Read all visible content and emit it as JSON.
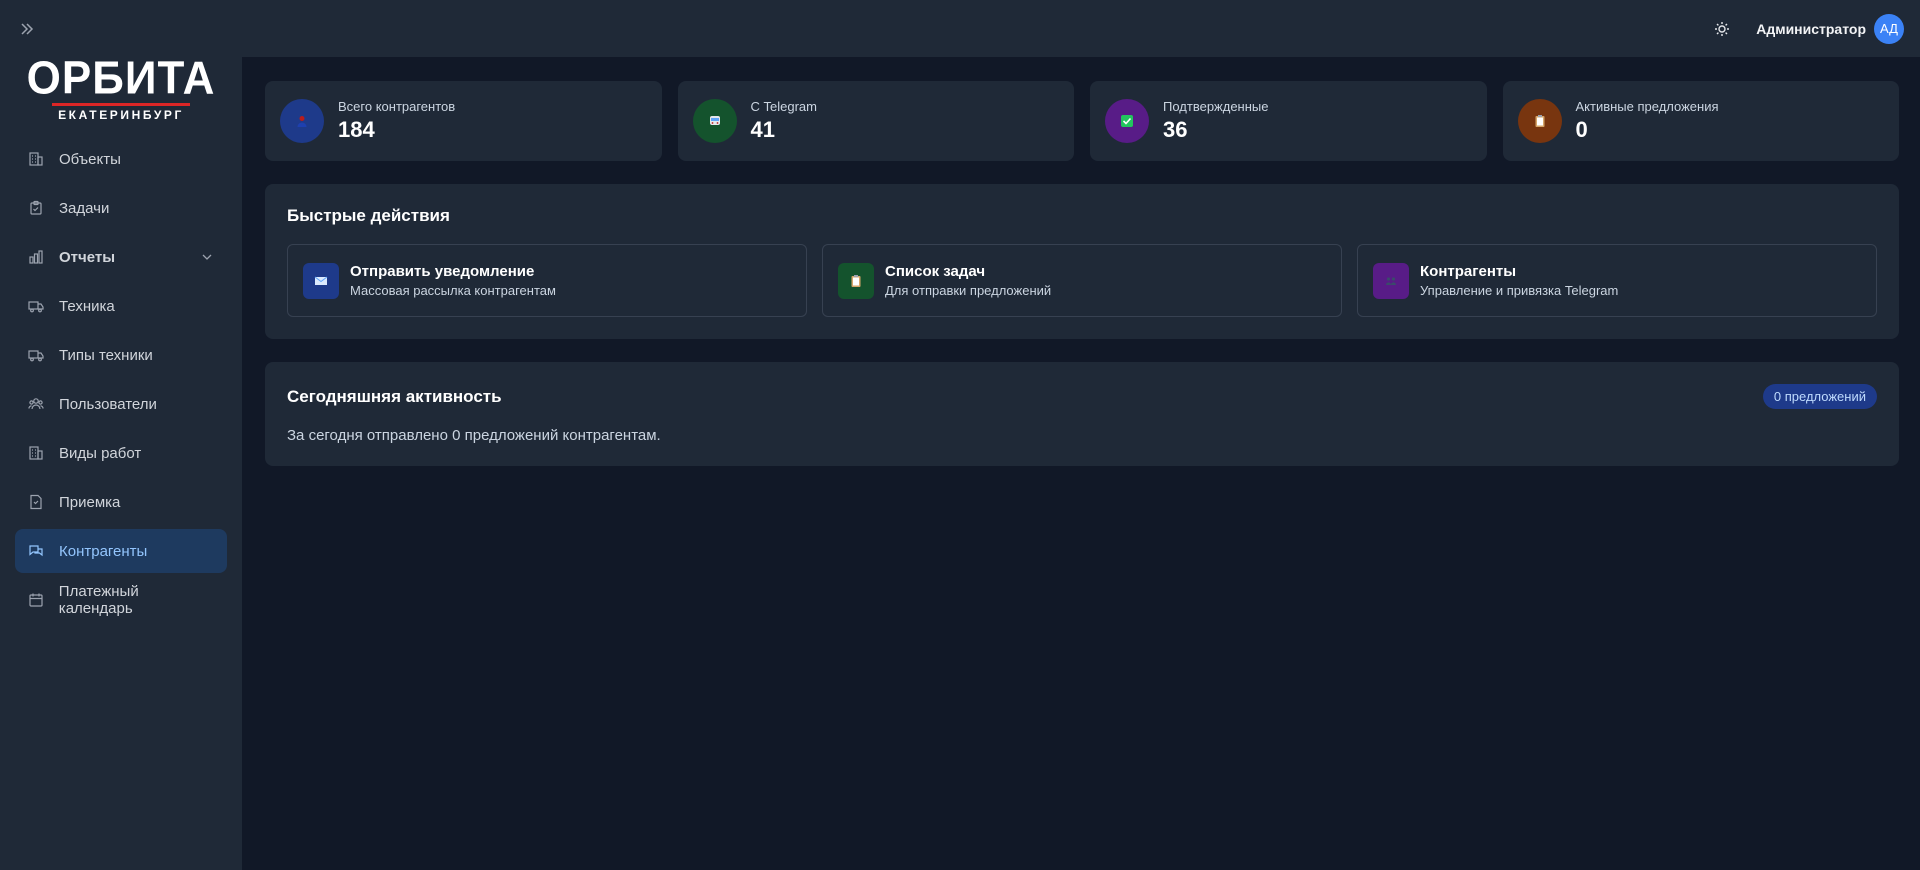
{
  "header": {
    "user_name": "Администратор",
    "avatar_initials": "АД"
  },
  "logo": {
    "main": "ОРБИТА",
    "sub": "ЕКАТЕРИНБУРГ"
  },
  "sidebar": {
    "items": [
      {
        "label": "Объекты",
        "icon": "building-icon"
      },
      {
        "label": "Задачи",
        "icon": "clipboard-icon"
      },
      {
        "label": "Отчеты",
        "icon": "bar-chart-icon"
      },
      {
        "label": "Техника",
        "icon": "truck-icon"
      },
      {
        "label": "Типы техники",
        "icon": "truck-icon"
      },
      {
        "label": "Пользователи",
        "icon": "users-icon"
      },
      {
        "label": "Виды работ",
        "icon": "building-icon"
      },
      {
        "label": "Приемка",
        "icon": "document-icon"
      },
      {
        "label": "Контрагенты",
        "icon": "chat-icon"
      },
      {
        "label": "Платежный календарь",
        "icon": "calendar-icon"
      }
    ]
  },
  "stats": [
    {
      "label": "Всего контрагентов",
      "value": "184",
      "color": "#1e3a8a",
      "icon": "person-icon"
    },
    {
      "label": "С Telegram",
      "value": "41",
      "color": "#14532d",
      "icon": "bus-icon"
    },
    {
      "label": "Подтвержденные",
      "value": "36",
      "color": "#581c87",
      "icon": "check-icon"
    },
    {
      "label": "Активные предложения",
      "value": "0",
      "color": "#78350f",
      "icon": "clipboard-icon"
    }
  ],
  "quick_actions": {
    "title": "Быстрые действия",
    "items": [
      {
        "title": "Отправить уведомление",
        "desc": "Массовая рассылка контрагентам",
        "color": "#1e3a8a",
        "icon": "envelope-icon"
      },
      {
        "title": "Список задач",
        "desc": "Для отправки предложений",
        "color": "#14532d",
        "icon": "clipboard-icon"
      },
      {
        "title": "Контрагенты",
        "desc": "Управление и привязка Telegram",
        "color": "#581c87",
        "icon": "people-icon"
      }
    ]
  },
  "activity": {
    "title": "Сегодняшняя активность",
    "badge": "0 предложений",
    "text": "За сегодня отправлено 0 предложений контрагентам."
  }
}
